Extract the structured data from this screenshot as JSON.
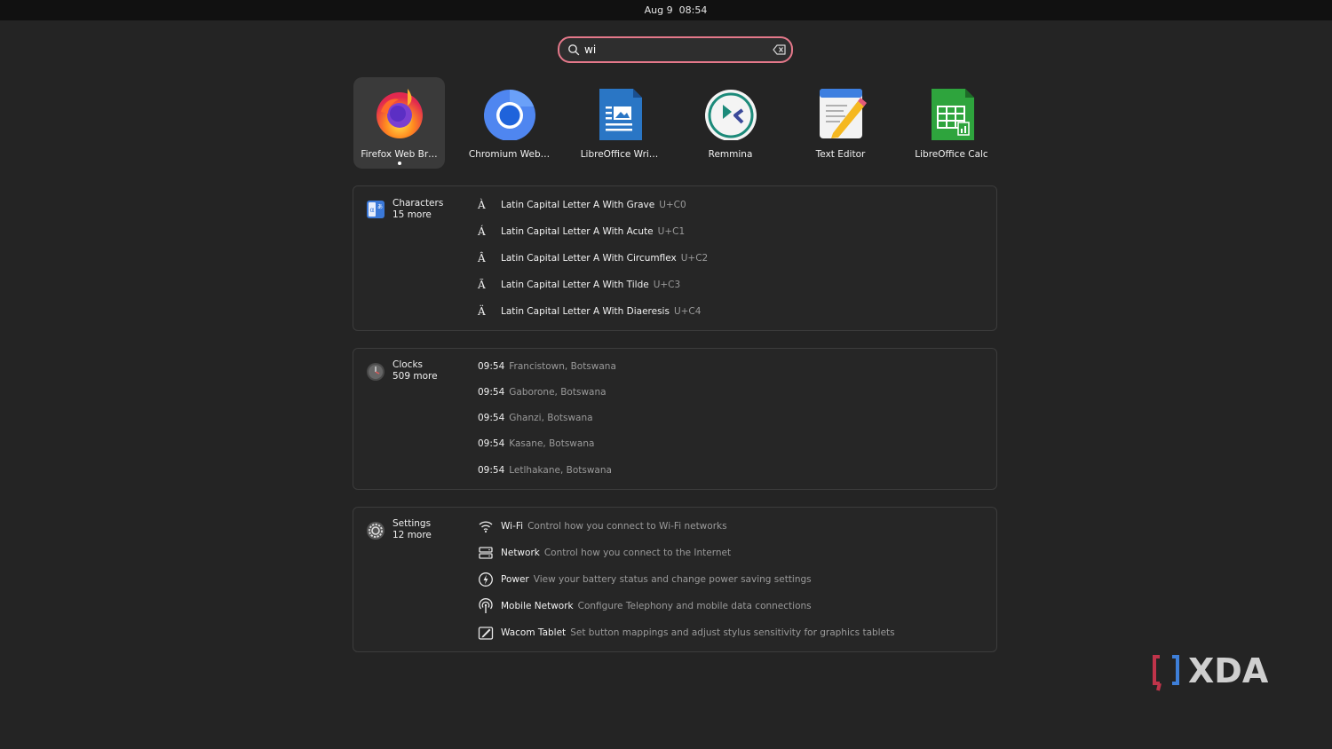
{
  "topbar": {
    "date": "Aug 9",
    "time": "08:54"
  },
  "search": {
    "value": "wi",
    "clear_icon": "edit-clear-icon"
  },
  "apps": [
    {
      "label": "Firefox Web Br…",
      "icon": "firefox-icon",
      "selected": true,
      "running": true
    },
    {
      "label": "Chromium Web…",
      "icon": "chromium-icon"
    },
    {
      "label": "LibreOffice Wri…",
      "icon": "libreoffice-writer-icon"
    },
    {
      "label": "Remmina",
      "icon": "remmina-icon"
    },
    {
      "label": "Text Editor",
      "icon": "text-editor-icon"
    },
    {
      "label": "LibreOffice Calc",
      "icon": "libreoffice-calc-icon"
    }
  ],
  "characters": {
    "name": "Characters",
    "more": "15 more",
    "items": [
      {
        "glyph": "À",
        "name": "Latin Capital Letter A With Grave",
        "code": "U+C0"
      },
      {
        "glyph": "Á",
        "name": "Latin Capital Letter A With Acute",
        "code": "U+C1"
      },
      {
        "glyph": "Â",
        "name": "Latin Capital Letter A With Circumflex",
        "code": "U+C2"
      },
      {
        "glyph": "Ã",
        "name": "Latin Capital Letter A With Tilde",
        "code": "U+C3"
      },
      {
        "glyph": "Ä",
        "name": "Latin Capital Letter A With Diaeresis",
        "code": "U+C4"
      }
    ]
  },
  "clocks": {
    "name": "Clocks",
    "more": "509 more",
    "items": [
      {
        "time": "09:54",
        "place": "Francistown, Botswana"
      },
      {
        "time": "09:54",
        "place": "Gaborone, Botswana"
      },
      {
        "time": "09:54",
        "place": "Ghanzi, Botswana"
      },
      {
        "time": "09:54",
        "place": "Kasane, Botswana"
      },
      {
        "time": "09:54",
        "place": "Letlhakane, Botswana"
      }
    ]
  },
  "settings": {
    "name": "Settings",
    "more": "12 more",
    "items": [
      {
        "icon": "wifi-icon",
        "title": "Wi-Fi",
        "desc": "Control how you connect to Wi-Fi networks"
      },
      {
        "icon": "network-icon",
        "title": "Network",
        "desc": "Control how you connect to the Internet"
      },
      {
        "icon": "power-icon",
        "title": "Power",
        "desc": "View your battery status and change power saving settings"
      },
      {
        "icon": "mobile-network-icon",
        "title": "Mobile Network",
        "desc": "Configure Telephony and mobile data connections"
      },
      {
        "icon": "wacom-tablet-icon",
        "title": "Wacom Tablet",
        "desc": "Set button mappings and adjust stylus sensitivity for graphics tablets"
      }
    ]
  },
  "watermark": {
    "text": "XDA"
  }
}
